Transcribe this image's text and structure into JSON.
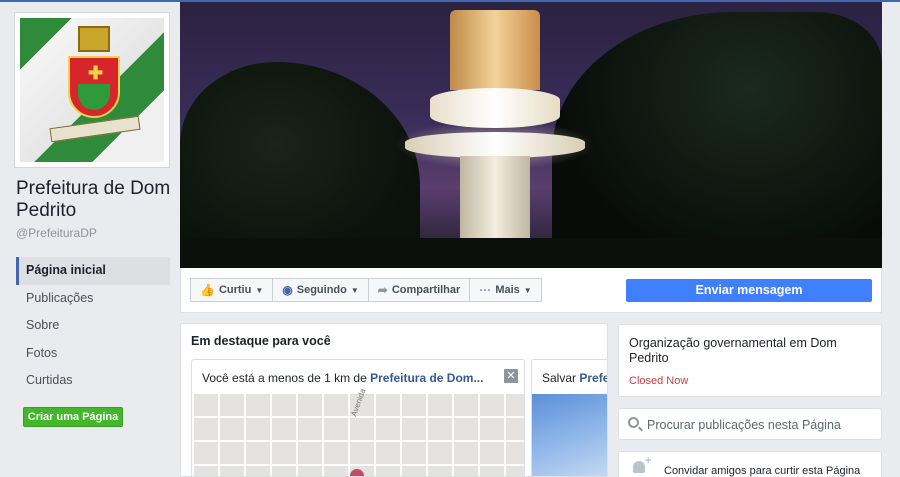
{
  "page": {
    "name": "Prefeitura de Dom Pedrito",
    "handle": "@PrefeituraDP"
  },
  "nav": {
    "items": [
      "Página inicial",
      "Publicações",
      "Sobre",
      "Fotos",
      "Curtidas"
    ],
    "active_index": 0
  },
  "create_page_label": "Criar uma Página",
  "actions": {
    "like": "Curtiu",
    "following": "Seguindo",
    "share": "Compartilhar",
    "more": "Mais",
    "send_message": "Enviar mensagem"
  },
  "highlights": {
    "title": "Em destaque para você",
    "card1": {
      "text_prefix": "Você está a menos de 1 km de ",
      "link": "Prefeitura de Dom...",
      "street": "Avenida"
    },
    "card2": {
      "text_prefix": "Salvar ",
      "link": "Prefe"
    }
  },
  "about": {
    "category": "Organização governamental em Dom Pedrito",
    "status": "Closed Now"
  },
  "search": {
    "placeholder": "Procurar publicações nesta Página"
  },
  "invite": {
    "label": "Convidar amigos para curtir esta Página"
  },
  "colors": {
    "facebook_blue": "#4267b2",
    "send_button": "#4080ff",
    "create_button": "#42b72a",
    "closed_status": "#c53f46",
    "link": "#365899"
  }
}
